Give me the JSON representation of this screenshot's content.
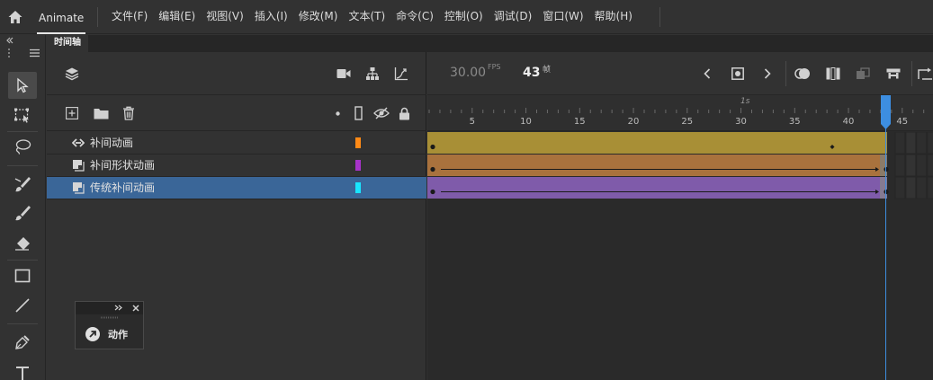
{
  "app": {
    "name": "Animate",
    "menus": [
      "文件(F)",
      "编辑(E)",
      "视图(V)",
      "插入(I)",
      "修改(M)",
      "文本(T)",
      "命令(C)",
      "控制(O)",
      "调试(D)",
      "窗口(W)",
      "帮助(H)"
    ]
  },
  "panel": {
    "tab": "时间轴"
  },
  "timeline": {
    "fps": "30.00",
    "fps_unit": "FPS",
    "current_frame": "43",
    "frame_unit": "帧",
    "seconds_marker": "1s",
    "ticks": [
      "5",
      "10",
      "15",
      "20",
      "25",
      "30",
      "35",
      "40",
      "45"
    ]
  },
  "layers": [
    {
      "name": "补间动画",
      "type": "motion",
      "color": "#ff8a16",
      "span_color": "#a88f36",
      "selected": false
    },
    {
      "name": "补间形状动画",
      "type": "shape",
      "color": "#a733c9",
      "span_color": "#a9723d",
      "selected": false
    },
    {
      "name": "传统补间动画",
      "type": "classic",
      "color": "#19e5ff",
      "span_color": "#7f5baa",
      "selected": true
    }
  ],
  "actions_panel": {
    "label": "动作"
  },
  "colors": {
    "playhead": "#3d8ee0",
    "selection": "#3a6698"
  }
}
